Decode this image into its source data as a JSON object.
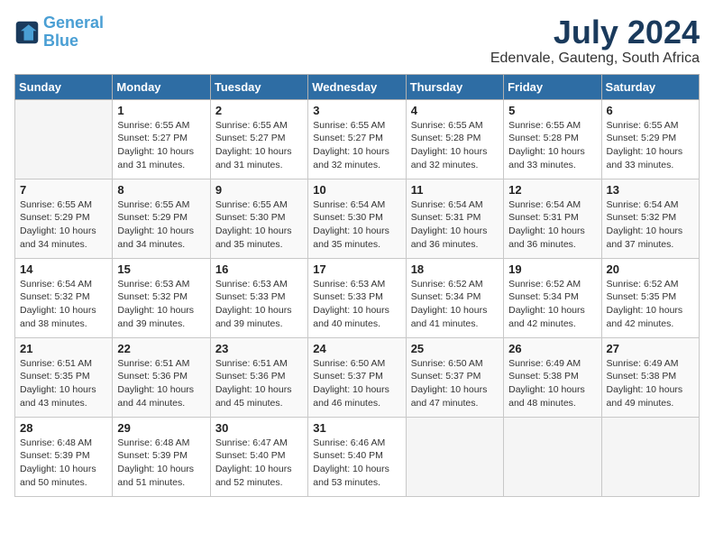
{
  "logo": {
    "line1": "General",
    "line2": "Blue"
  },
  "title": "July 2024",
  "location": "Edenvale, Gauteng, South Africa",
  "headers": [
    "Sunday",
    "Monday",
    "Tuesday",
    "Wednesday",
    "Thursday",
    "Friday",
    "Saturday"
  ],
  "weeks": [
    [
      {
        "num": "",
        "empty": true
      },
      {
        "num": "1",
        "sunrise": "6:55 AM",
        "sunset": "5:27 PM",
        "daylight": "10 hours and 31 minutes."
      },
      {
        "num": "2",
        "sunrise": "6:55 AM",
        "sunset": "5:27 PM",
        "daylight": "10 hours and 31 minutes."
      },
      {
        "num": "3",
        "sunrise": "6:55 AM",
        "sunset": "5:27 PM",
        "daylight": "10 hours and 32 minutes."
      },
      {
        "num": "4",
        "sunrise": "6:55 AM",
        "sunset": "5:28 PM",
        "daylight": "10 hours and 32 minutes."
      },
      {
        "num": "5",
        "sunrise": "6:55 AM",
        "sunset": "5:28 PM",
        "daylight": "10 hours and 33 minutes."
      },
      {
        "num": "6",
        "sunrise": "6:55 AM",
        "sunset": "5:29 PM",
        "daylight": "10 hours and 33 minutes."
      }
    ],
    [
      {
        "num": "7",
        "sunrise": "6:55 AM",
        "sunset": "5:29 PM",
        "daylight": "10 hours and 34 minutes."
      },
      {
        "num": "8",
        "sunrise": "6:55 AM",
        "sunset": "5:29 PM",
        "daylight": "10 hours and 34 minutes."
      },
      {
        "num": "9",
        "sunrise": "6:55 AM",
        "sunset": "5:30 PM",
        "daylight": "10 hours and 35 minutes."
      },
      {
        "num": "10",
        "sunrise": "6:54 AM",
        "sunset": "5:30 PM",
        "daylight": "10 hours and 35 minutes."
      },
      {
        "num": "11",
        "sunrise": "6:54 AM",
        "sunset": "5:31 PM",
        "daylight": "10 hours and 36 minutes."
      },
      {
        "num": "12",
        "sunrise": "6:54 AM",
        "sunset": "5:31 PM",
        "daylight": "10 hours and 36 minutes."
      },
      {
        "num": "13",
        "sunrise": "6:54 AM",
        "sunset": "5:32 PM",
        "daylight": "10 hours and 37 minutes."
      }
    ],
    [
      {
        "num": "14",
        "sunrise": "6:54 AM",
        "sunset": "5:32 PM",
        "daylight": "10 hours and 38 minutes."
      },
      {
        "num": "15",
        "sunrise": "6:53 AM",
        "sunset": "5:32 PM",
        "daylight": "10 hours and 39 minutes."
      },
      {
        "num": "16",
        "sunrise": "6:53 AM",
        "sunset": "5:33 PM",
        "daylight": "10 hours and 39 minutes."
      },
      {
        "num": "17",
        "sunrise": "6:53 AM",
        "sunset": "5:33 PM",
        "daylight": "10 hours and 40 minutes."
      },
      {
        "num": "18",
        "sunrise": "6:52 AM",
        "sunset": "5:34 PM",
        "daylight": "10 hours and 41 minutes."
      },
      {
        "num": "19",
        "sunrise": "6:52 AM",
        "sunset": "5:34 PM",
        "daylight": "10 hours and 42 minutes."
      },
      {
        "num": "20",
        "sunrise": "6:52 AM",
        "sunset": "5:35 PM",
        "daylight": "10 hours and 42 minutes."
      }
    ],
    [
      {
        "num": "21",
        "sunrise": "6:51 AM",
        "sunset": "5:35 PM",
        "daylight": "10 hours and 43 minutes."
      },
      {
        "num": "22",
        "sunrise": "6:51 AM",
        "sunset": "5:36 PM",
        "daylight": "10 hours and 44 minutes."
      },
      {
        "num": "23",
        "sunrise": "6:51 AM",
        "sunset": "5:36 PM",
        "daylight": "10 hours and 45 minutes."
      },
      {
        "num": "24",
        "sunrise": "6:50 AM",
        "sunset": "5:37 PM",
        "daylight": "10 hours and 46 minutes."
      },
      {
        "num": "25",
        "sunrise": "6:50 AM",
        "sunset": "5:37 PM",
        "daylight": "10 hours and 47 minutes."
      },
      {
        "num": "26",
        "sunrise": "6:49 AM",
        "sunset": "5:38 PM",
        "daylight": "10 hours and 48 minutes."
      },
      {
        "num": "27",
        "sunrise": "6:49 AM",
        "sunset": "5:38 PM",
        "daylight": "10 hours and 49 minutes."
      }
    ],
    [
      {
        "num": "28",
        "sunrise": "6:48 AM",
        "sunset": "5:39 PM",
        "daylight": "10 hours and 50 minutes."
      },
      {
        "num": "29",
        "sunrise": "6:48 AM",
        "sunset": "5:39 PM",
        "daylight": "10 hours and 51 minutes."
      },
      {
        "num": "30",
        "sunrise": "6:47 AM",
        "sunset": "5:40 PM",
        "daylight": "10 hours and 52 minutes."
      },
      {
        "num": "31",
        "sunrise": "6:46 AM",
        "sunset": "5:40 PM",
        "daylight": "10 hours and 53 minutes."
      },
      {
        "num": "",
        "empty": true
      },
      {
        "num": "",
        "empty": true
      },
      {
        "num": "",
        "empty": true
      }
    ]
  ]
}
